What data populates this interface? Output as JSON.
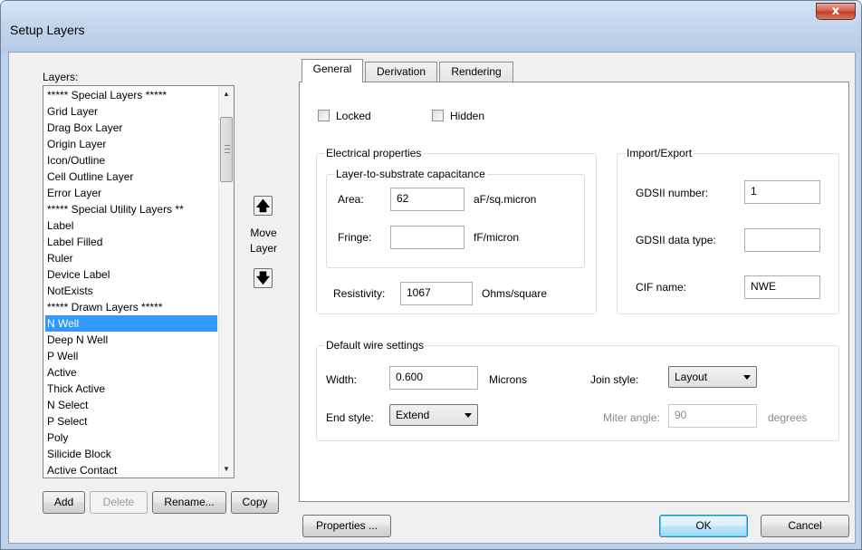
{
  "window": {
    "title": "Setup Layers",
    "close_glyph": "x"
  },
  "layers": {
    "label": "Layers:",
    "items": [
      "***** Special Layers *****",
      "Grid Layer",
      "Drag Box Layer",
      "Origin Layer",
      "Icon/Outline",
      "Cell Outline Layer",
      "Error Layer",
      "***** Special Utility Layers **",
      "Label",
      "Label Filled",
      "Ruler",
      "Device Label",
      "NotExists",
      "***** Drawn Layers *****",
      "N Well",
      "Deep N Well",
      "P Well",
      "Active",
      "Thick Active",
      "N Select",
      "P Select",
      "Poly",
      "Silicide Block",
      "Active Contact"
    ],
    "selected": "N Well",
    "buttons": {
      "add": "Add",
      "delete": "Delete",
      "rename": "Rename...",
      "copy": "Copy"
    }
  },
  "move_layer": {
    "line1": "Move",
    "line2": "Layer",
    "up_glyph": "🡅",
    "down_glyph": "🡇"
  },
  "tabs": [
    {
      "label": "General",
      "active": true
    },
    {
      "label": "Derivation",
      "active": false
    },
    {
      "label": "Rendering",
      "active": false
    }
  ],
  "general": {
    "locked_label": "Locked",
    "hidden_label": "Hidden",
    "electrical": {
      "title": "Electrical properties",
      "capacitance_title": "Layer-to-substrate capacitance",
      "area_label": "Area:",
      "area_value": "62",
      "area_unit": "aF/sq.micron",
      "fringe_label": "Fringe:",
      "fringe_value": "",
      "fringe_unit": "fF/micron",
      "resistivity_label": "Resistivity:",
      "resistivity_value": "1067",
      "resistivity_unit": "Ohms/square"
    },
    "import_export": {
      "title": "Import/Export",
      "gdsii_number_label": "GDSII number:",
      "gdsii_number_value": "1",
      "gdsii_type_label": "GDSII data type:",
      "gdsii_type_value": "",
      "cif_label": "CIF name:",
      "cif_value": "NWE"
    },
    "wire": {
      "title": "Default wire settings",
      "width_label": "Width:",
      "width_value": "0.600",
      "width_unit": "Microns",
      "join_label": "Join style:",
      "join_value": "Layout",
      "end_label": "End style:",
      "end_value": "Extend",
      "miter_label": "Miter angle:",
      "miter_value": "90",
      "miter_unit": "degrees"
    }
  },
  "footer": {
    "properties": "Properties ...",
    "ok": "OK",
    "cancel": "Cancel"
  }
}
